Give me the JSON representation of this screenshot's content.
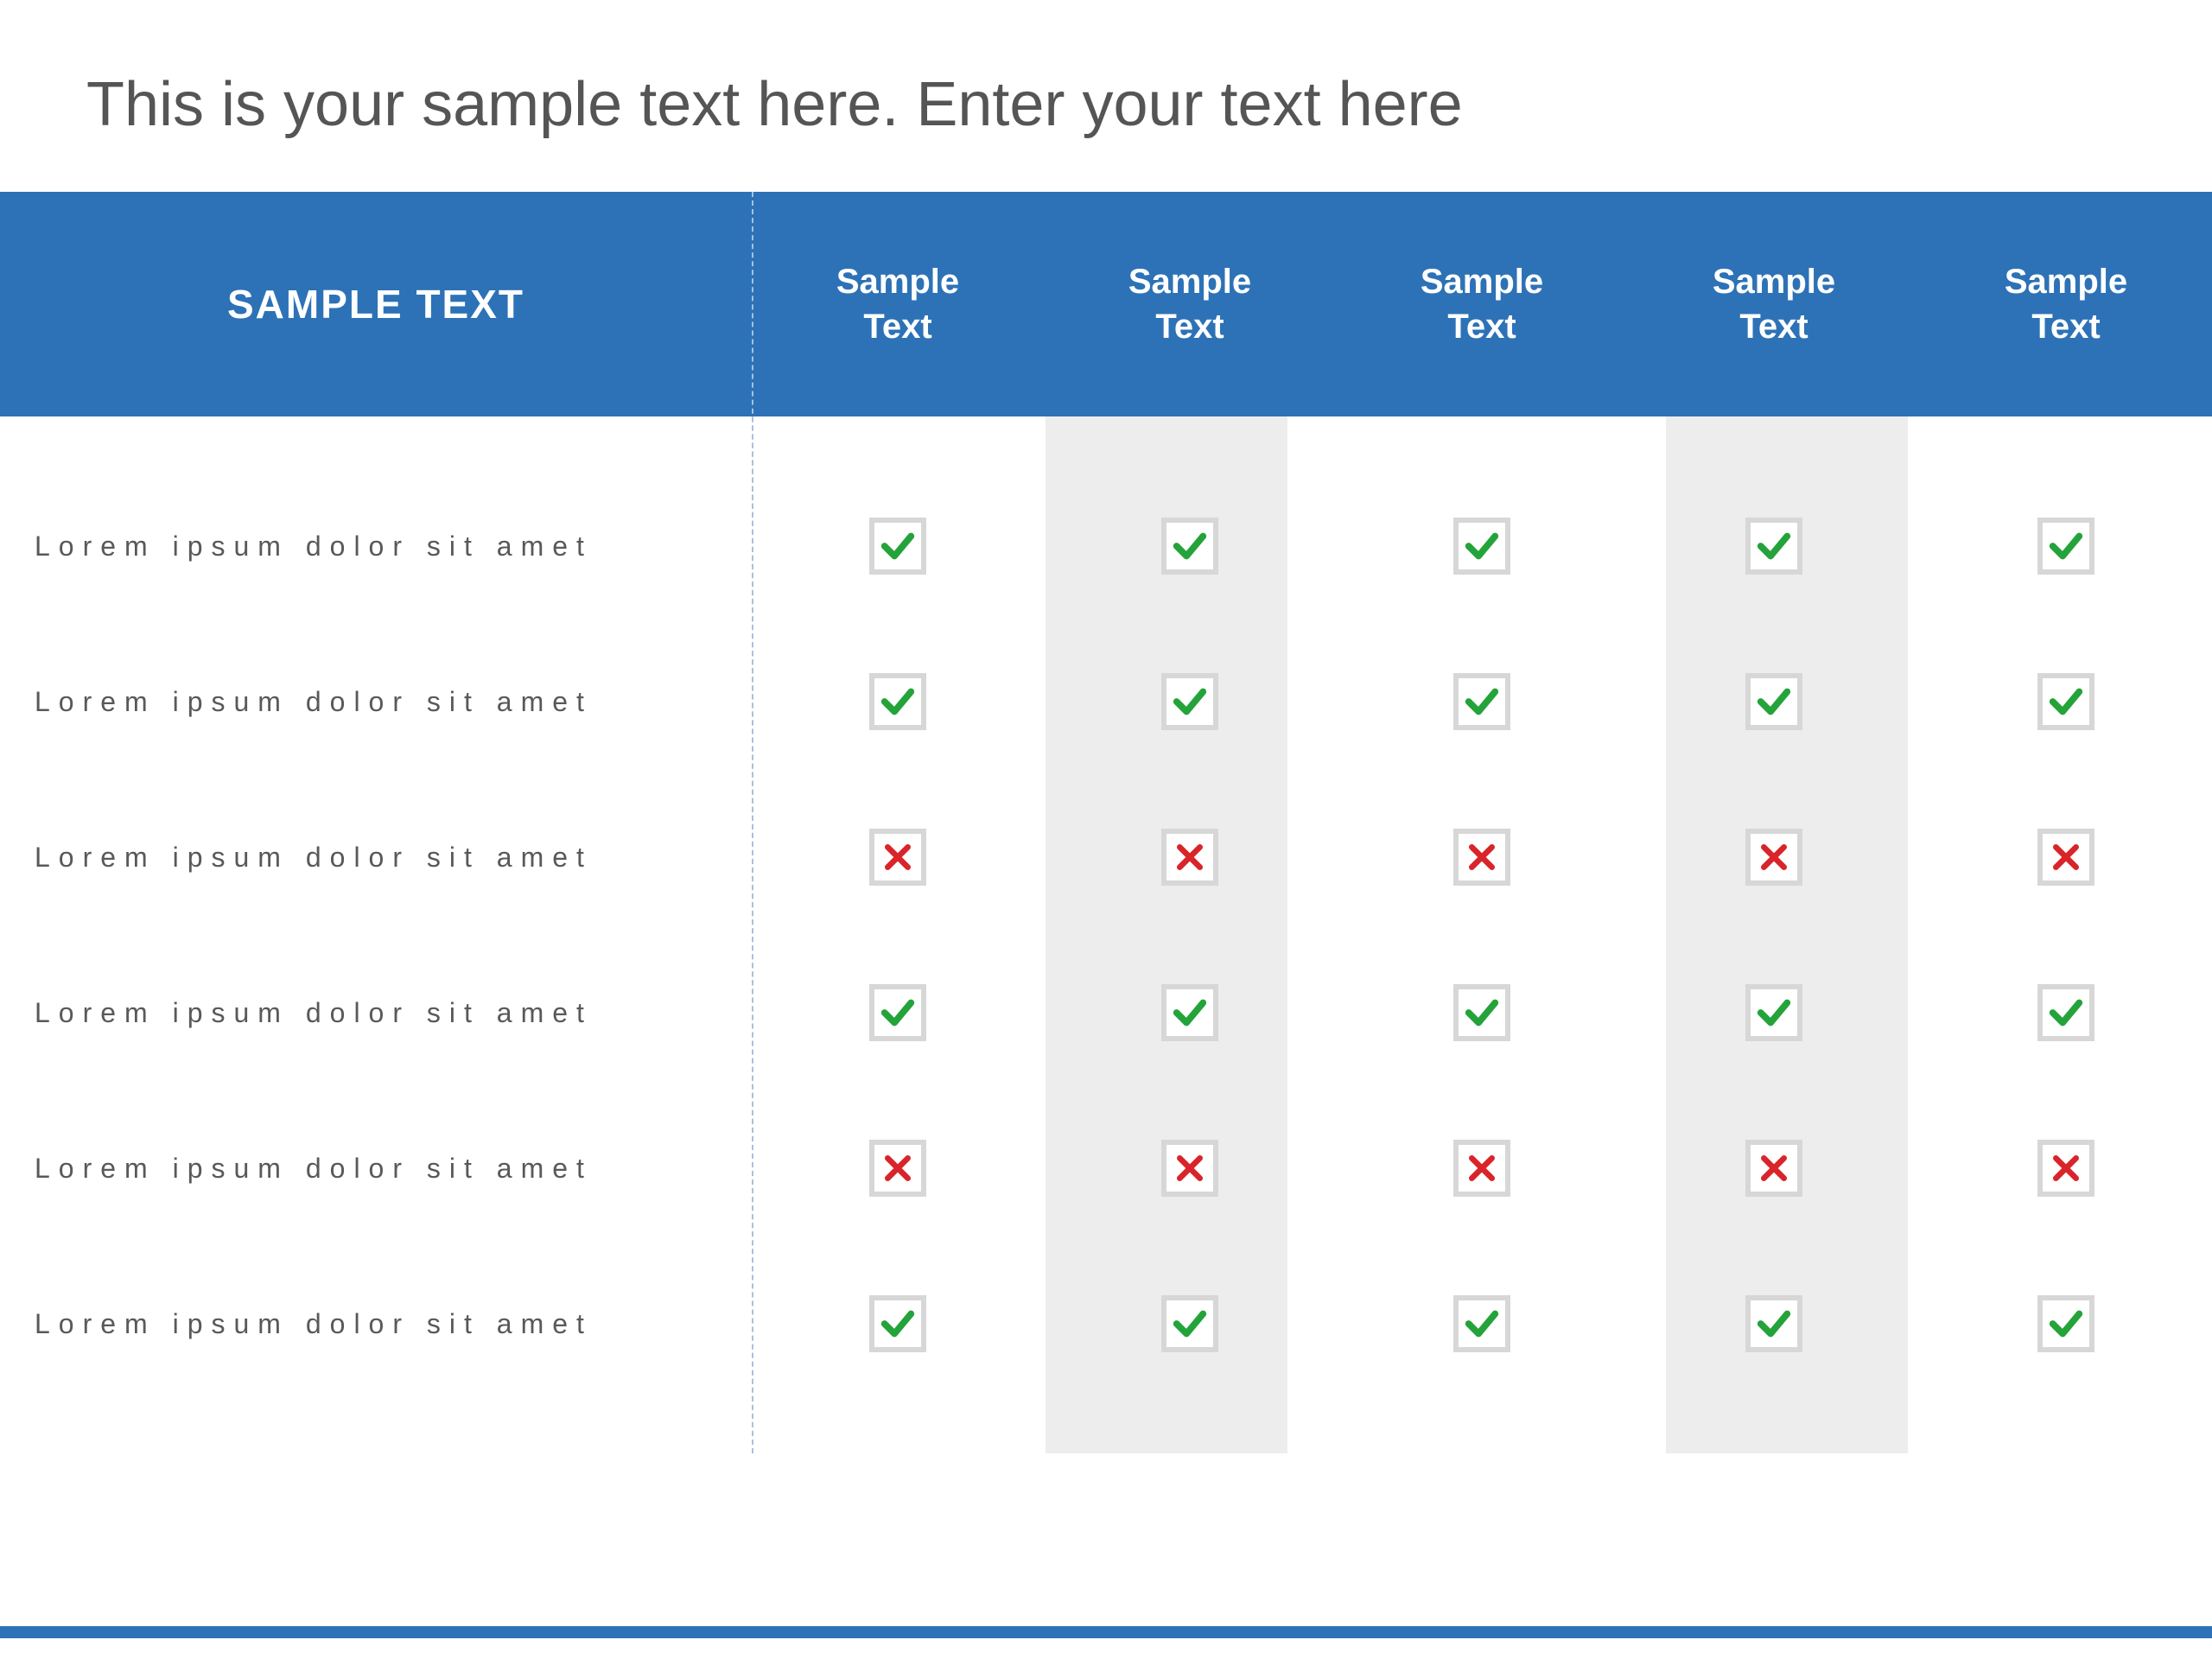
{
  "title": "This is your sample text here. Enter your text here",
  "header": {
    "main": "SAMPLE TEXT",
    "cols": [
      "Sample\nText",
      "Sample\nText",
      "Sample\nText",
      "Sample\nText",
      "Sample\nText"
    ]
  },
  "rows": [
    {
      "label": "Lorem ipsum dolor sit amet",
      "values": [
        "check",
        "check",
        "check",
        "check",
        "check"
      ]
    },
    {
      "label": "Lorem ipsum dolor sit amet",
      "values": [
        "check",
        "check",
        "check",
        "check",
        "check"
      ]
    },
    {
      "label": "Lorem ipsum dolor sit amet",
      "values": [
        "cross",
        "cross",
        "cross",
        "cross",
        "cross"
      ]
    },
    {
      "label": "Lorem ipsum dolor sit amet",
      "values": [
        "check",
        "check",
        "check",
        "check",
        "check"
      ]
    },
    {
      "label": "Lorem ipsum dolor sit amet",
      "values": [
        "cross",
        "cross",
        "cross",
        "cross",
        "cross"
      ]
    },
    {
      "label": "Lorem ipsum dolor sit amet",
      "values": [
        "check",
        "check",
        "check",
        "check",
        "check"
      ]
    }
  ],
  "colors": {
    "headerBg": "#2d72b6",
    "check": "#24a33a",
    "cross": "#d9252a",
    "shade": "#ededed"
  }
}
